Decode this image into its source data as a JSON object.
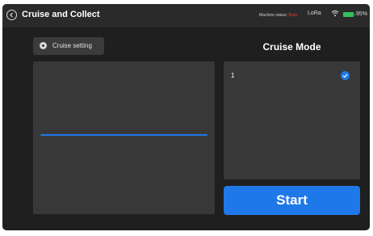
{
  "header": {
    "title": "Cruise and Collect",
    "status_prefix": "Machine status:",
    "status_value": "Busy",
    "lora": "LoRa",
    "battery": "95%",
    "battery_level_percent": 95,
    "icons": {
      "back": "back-arrow-icon",
      "wifi": "wifi-icon",
      "battery": "battery-icon"
    }
  },
  "toolbar": {
    "setting_label": "Cruise setting",
    "setting_icon": "gear-icon"
  },
  "mode": {
    "title": "Cruise Mode",
    "items": [
      {
        "label": "1",
        "selected": true
      }
    ]
  },
  "start_label": "Start",
  "colors": {
    "accent": "#1f78e8",
    "panel": "#383838",
    "background": "#1f1f1f",
    "battery": "#35c05a",
    "busy": "#e3402f"
  }
}
